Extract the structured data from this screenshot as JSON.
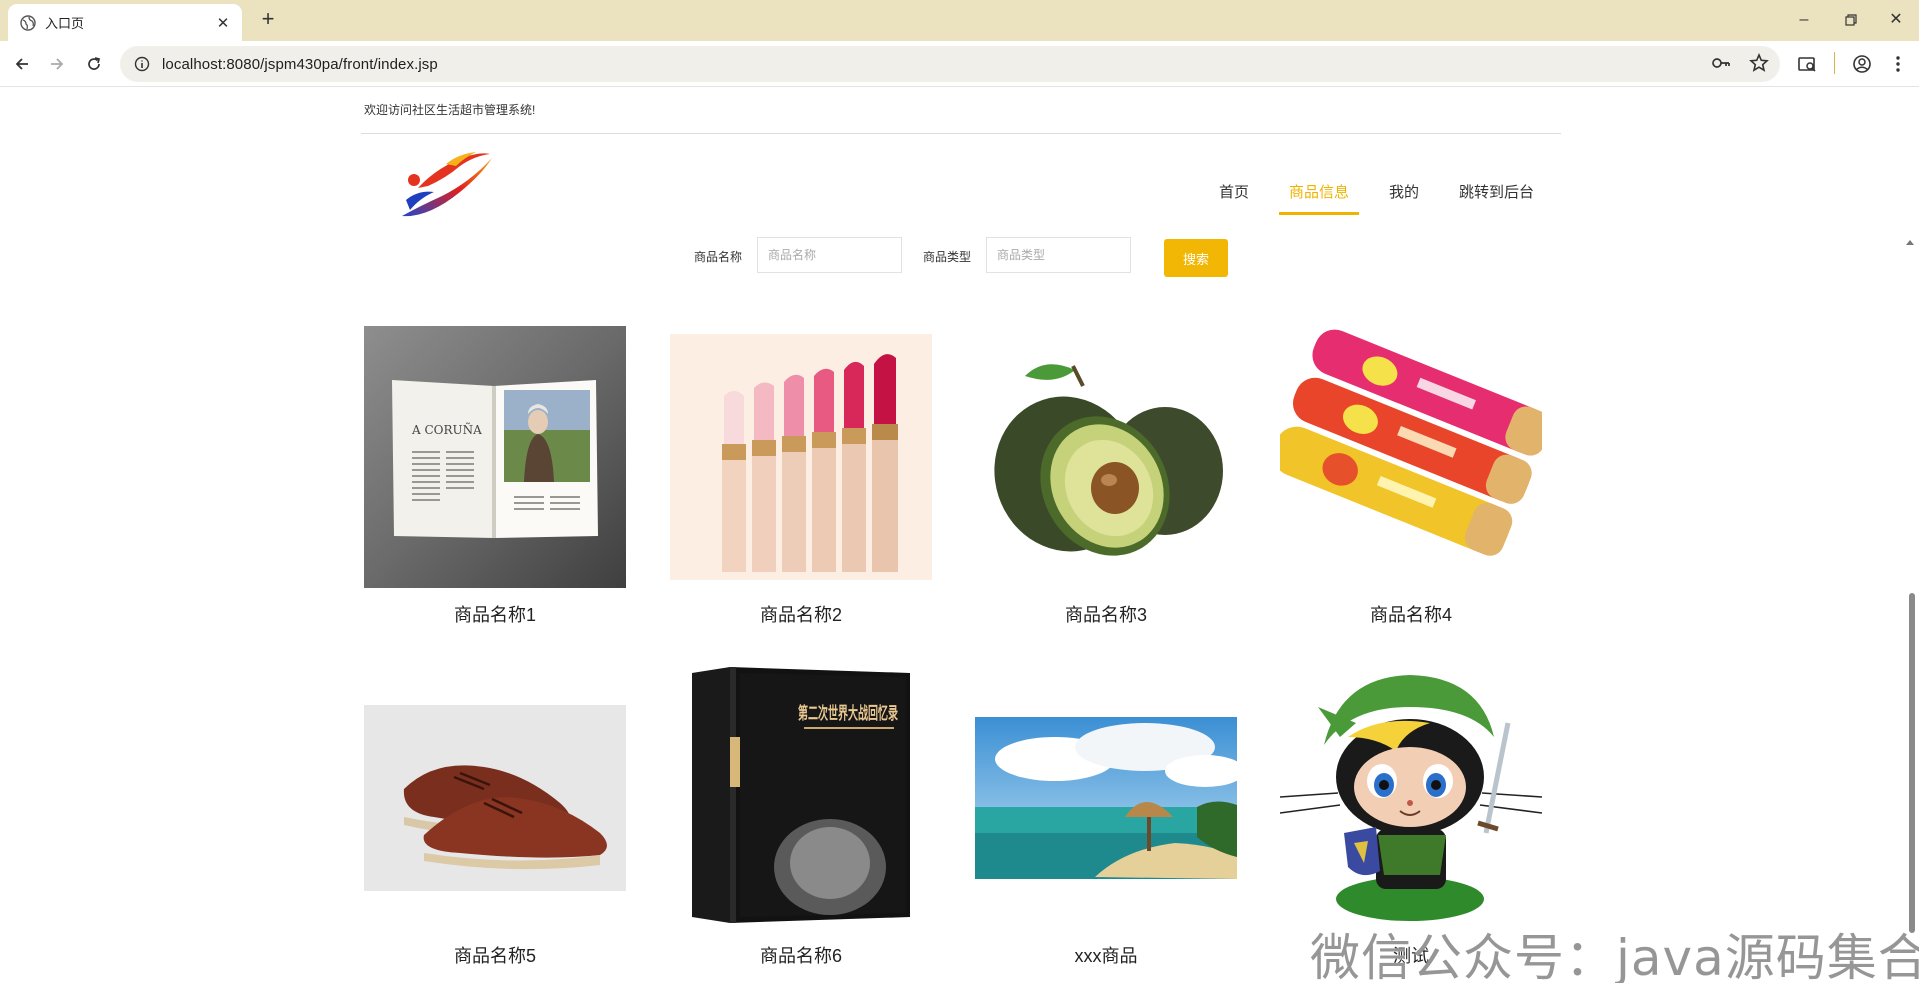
{
  "browser": {
    "tab_title": "入口页",
    "new_tab_label": "+",
    "url": "localhost:8080/jspm430pa/front/index.jsp"
  },
  "site": {
    "welcome": "欢迎访问社区生活超市管理系统!"
  },
  "nav": {
    "items": [
      "首页",
      "商品信息",
      "我的",
      "跳转到后台"
    ],
    "active": "商品信息",
    "accent_color": "#f0b400"
  },
  "search": {
    "name_label": "商品名称",
    "name_placeholder": "商品名称",
    "type_label": "商品类型",
    "type_placeholder": "商品类型",
    "button_label": "搜索",
    "button_color": "#f2b705"
  },
  "products": [
    {
      "name": "商品名称1",
      "image": "open-magazine"
    },
    {
      "name": "商品名称2",
      "image": "lipsticks"
    },
    {
      "name": "商品名称3",
      "image": "avocado"
    },
    {
      "name": "商品名称4",
      "image": "chip-cans"
    },
    {
      "name": "商品名称5",
      "image": "leather-shoes"
    },
    {
      "name": "商品名称6",
      "image": "book-boxset"
    },
    {
      "name": "xxx商品",
      "image": "beach-hut"
    },
    {
      "name": "测试",
      "image": "octocat-link"
    }
  ],
  "book_cover_text": "第二次世界大战回忆录",
  "magazine_text": "A CORUÑA",
  "watermark": "微信公众号：java源码集合"
}
